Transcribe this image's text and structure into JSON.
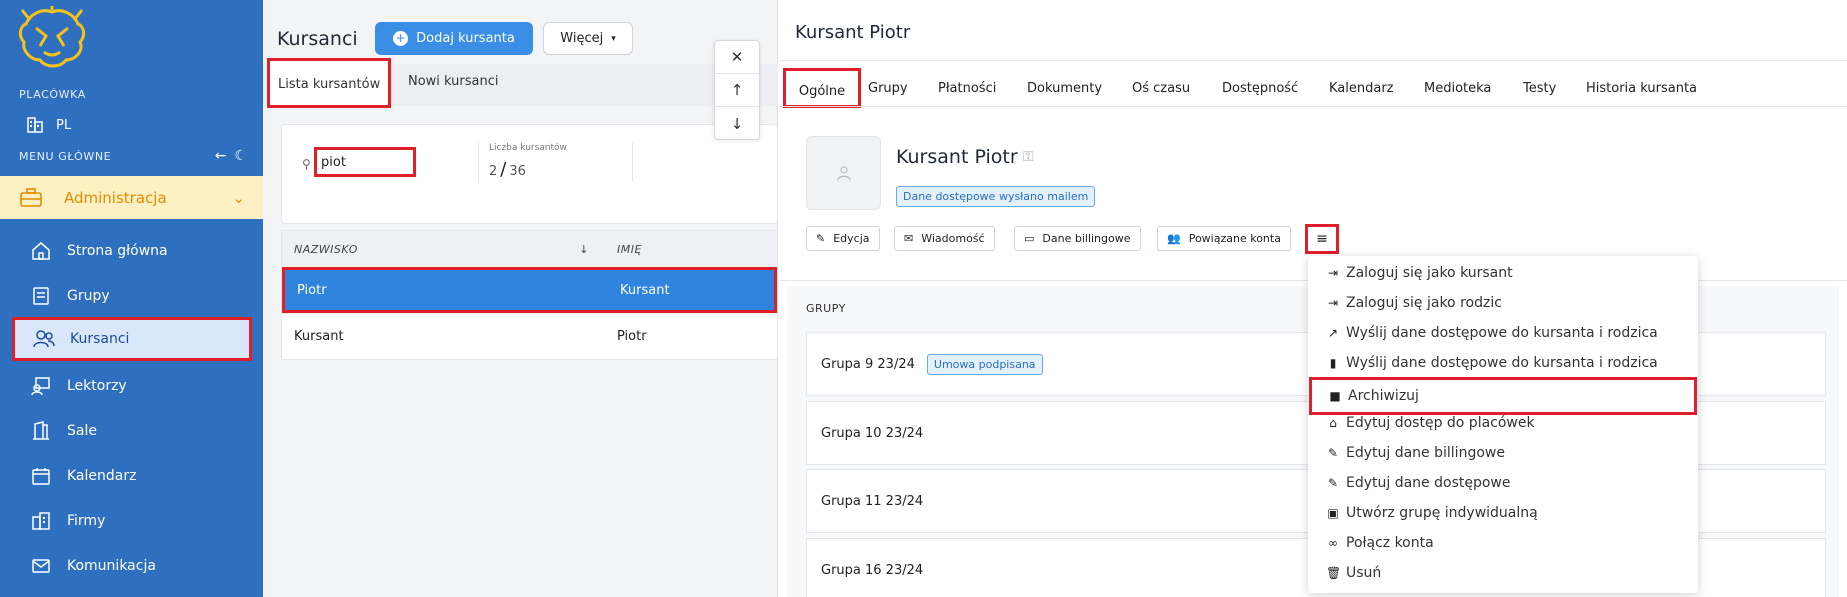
{
  "sidebar": {
    "location_label": "PLACÓWKA",
    "location_value": "PL",
    "menu_label": "MENU GŁÓWNE",
    "admin_label": "Administracja",
    "items": [
      {
        "label": "Strona główna",
        "icon": "home-icon"
      },
      {
        "label": "Grupy",
        "icon": "groups-icon"
      },
      {
        "label": "Kursanci",
        "icon": "students-icon"
      },
      {
        "label": "Lektorzy",
        "icon": "teachers-icon"
      },
      {
        "label": "Sale",
        "icon": "rooms-icon"
      },
      {
        "label": "Kalendarz",
        "icon": "calendar-icon"
      },
      {
        "label": "Firmy",
        "icon": "companies-icon"
      },
      {
        "label": "Komunikacja",
        "icon": "mail-icon"
      }
    ]
  },
  "list": {
    "title": "Kursanci",
    "add_label": "Dodaj kursanta",
    "more_label": "Więcej",
    "tabs": [
      "Lista kursantów",
      "Nowi kursanci"
    ],
    "search_value": "piot",
    "count_label": "Liczba kursantów",
    "count_shown": "2",
    "count_total": "36",
    "headers": [
      "NAZWISKO",
      "IMIĘ"
    ],
    "rows": [
      {
        "last": "Piotr",
        "first": "Kursant"
      },
      {
        "last": "Kursant",
        "first": "Piotr"
      }
    ]
  },
  "detail": {
    "title": "Kursant Piotr",
    "tabs": [
      "Ogólne",
      "Grupy",
      "Płatności",
      "Dokumenty",
      "Oś czasu",
      "Dostępność",
      "Kalendarz",
      "Medioteka",
      "Testy",
      "Historia kursanta"
    ],
    "name": "Kursant Piotr",
    "badge": "Dane dostępowe wysłano mailem",
    "actions": [
      "Edycja",
      "Wiadomość",
      "Dane billingowe",
      "Powiązane konta"
    ],
    "groups_label": "GRUPY",
    "groups": [
      {
        "name": "Grupa 9 23/24",
        "badge": "Umowa podpisana"
      },
      {
        "name": "Grupa 10 23/24",
        "badge": ""
      },
      {
        "name": "Grupa 11 23/24",
        "badge": ""
      },
      {
        "name": "Grupa 16 23/24",
        "badge": ""
      }
    ]
  },
  "dropdown": {
    "items": [
      {
        "label": "Zaloguj się jako kursant",
        "icon": "login-icon"
      },
      {
        "label": "Zaloguj się jako rodzic",
        "icon": "login-icon"
      },
      {
        "label": "Wyślij dane dostępowe do kursanta i rodzica",
        "icon": "share-icon"
      },
      {
        "label": "Wyślij dane dostępowe do kursanta i rodzica",
        "icon": "phone-icon"
      },
      {
        "label": "Archiwizuj",
        "icon": "folder-icon"
      },
      {
        "label": "Edytuj dostęp do placówek",
        "icon": "home-icon"
      },
      {
        "label": "Edytuj dane billingowe",
        "icon": "edit-icon"
      },
      {
        "label": "Edytuj dane dostępowe",
        "icon": "edit-icon"
      },
      {
        "label": "Utwórz grupę indywidualną",
        "icon": "book-icon"
      },
      {
        "label": "Połącz konta",
        "icon": "link-icon"
      },
      {
        "label": "Usuń",
        "icon": "trash-icon"
      }
    ]
  },
  "colors": {
    "sidebar_bg": "#2f6fc0",
    "accent": "#3a8ee6",
    "highlight": "#e01f2b",
    "admin_bg": "#fdf1c3",
    "admin_text": "#e38b00"
  }
}
